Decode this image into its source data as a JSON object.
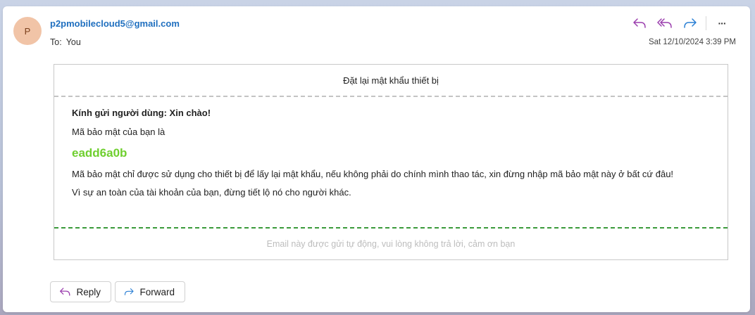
{
  "sender": {
    "initial": "P",
    "email": "p2pmobilecloud5@gmail.com"
  },
  "recipient": {
    "label": "To:",
    "value": "You"
  },
  "date": "Sat 12/10/2024 3:39 PM",
  "toolbar": {
    "icons": [
      "reply-icon",
      "reply-all-icon",
      "forward-icon",
      "more-icon"
    ],
    "more_label": "···"
  },
  "email": {
    "header": "Đặt lại mật khẩu thiết bị",
    "greeting": "Kính gửi người dùng: Xin chào!",
    "intro": "Mã bảo mật của bạn là",
    "code": "eadd6a0b",
    "paragraph1": "Mã bảo mật chỉ được sử dụng cho thiết bị để lấy lại mật khẩu, nếu không phải do chính mình thao tác, xin đừng nhập mã bảo mật này ở bất cứ đâu!",
    "paragraph2": "Vì sự an toàn của tài khoản của bạn, đừng tiết lộ nó cho người khác.",
    "footer": "Email này được gửi tự động, vui lòng không trả lời, cảm ơn bạn"
  },
  "buttons": {
    "reply": "Reply",
    "forward": "Forward"
  },
  "colors": {
    "link": "#1f6fbf",
    "code": "#6fcf2f",
    "reply_icon": "#9b3fae",
    "forward_icon": "#2a7fd4",
    "footer_divider": "#3a9a3a"
  }
}
